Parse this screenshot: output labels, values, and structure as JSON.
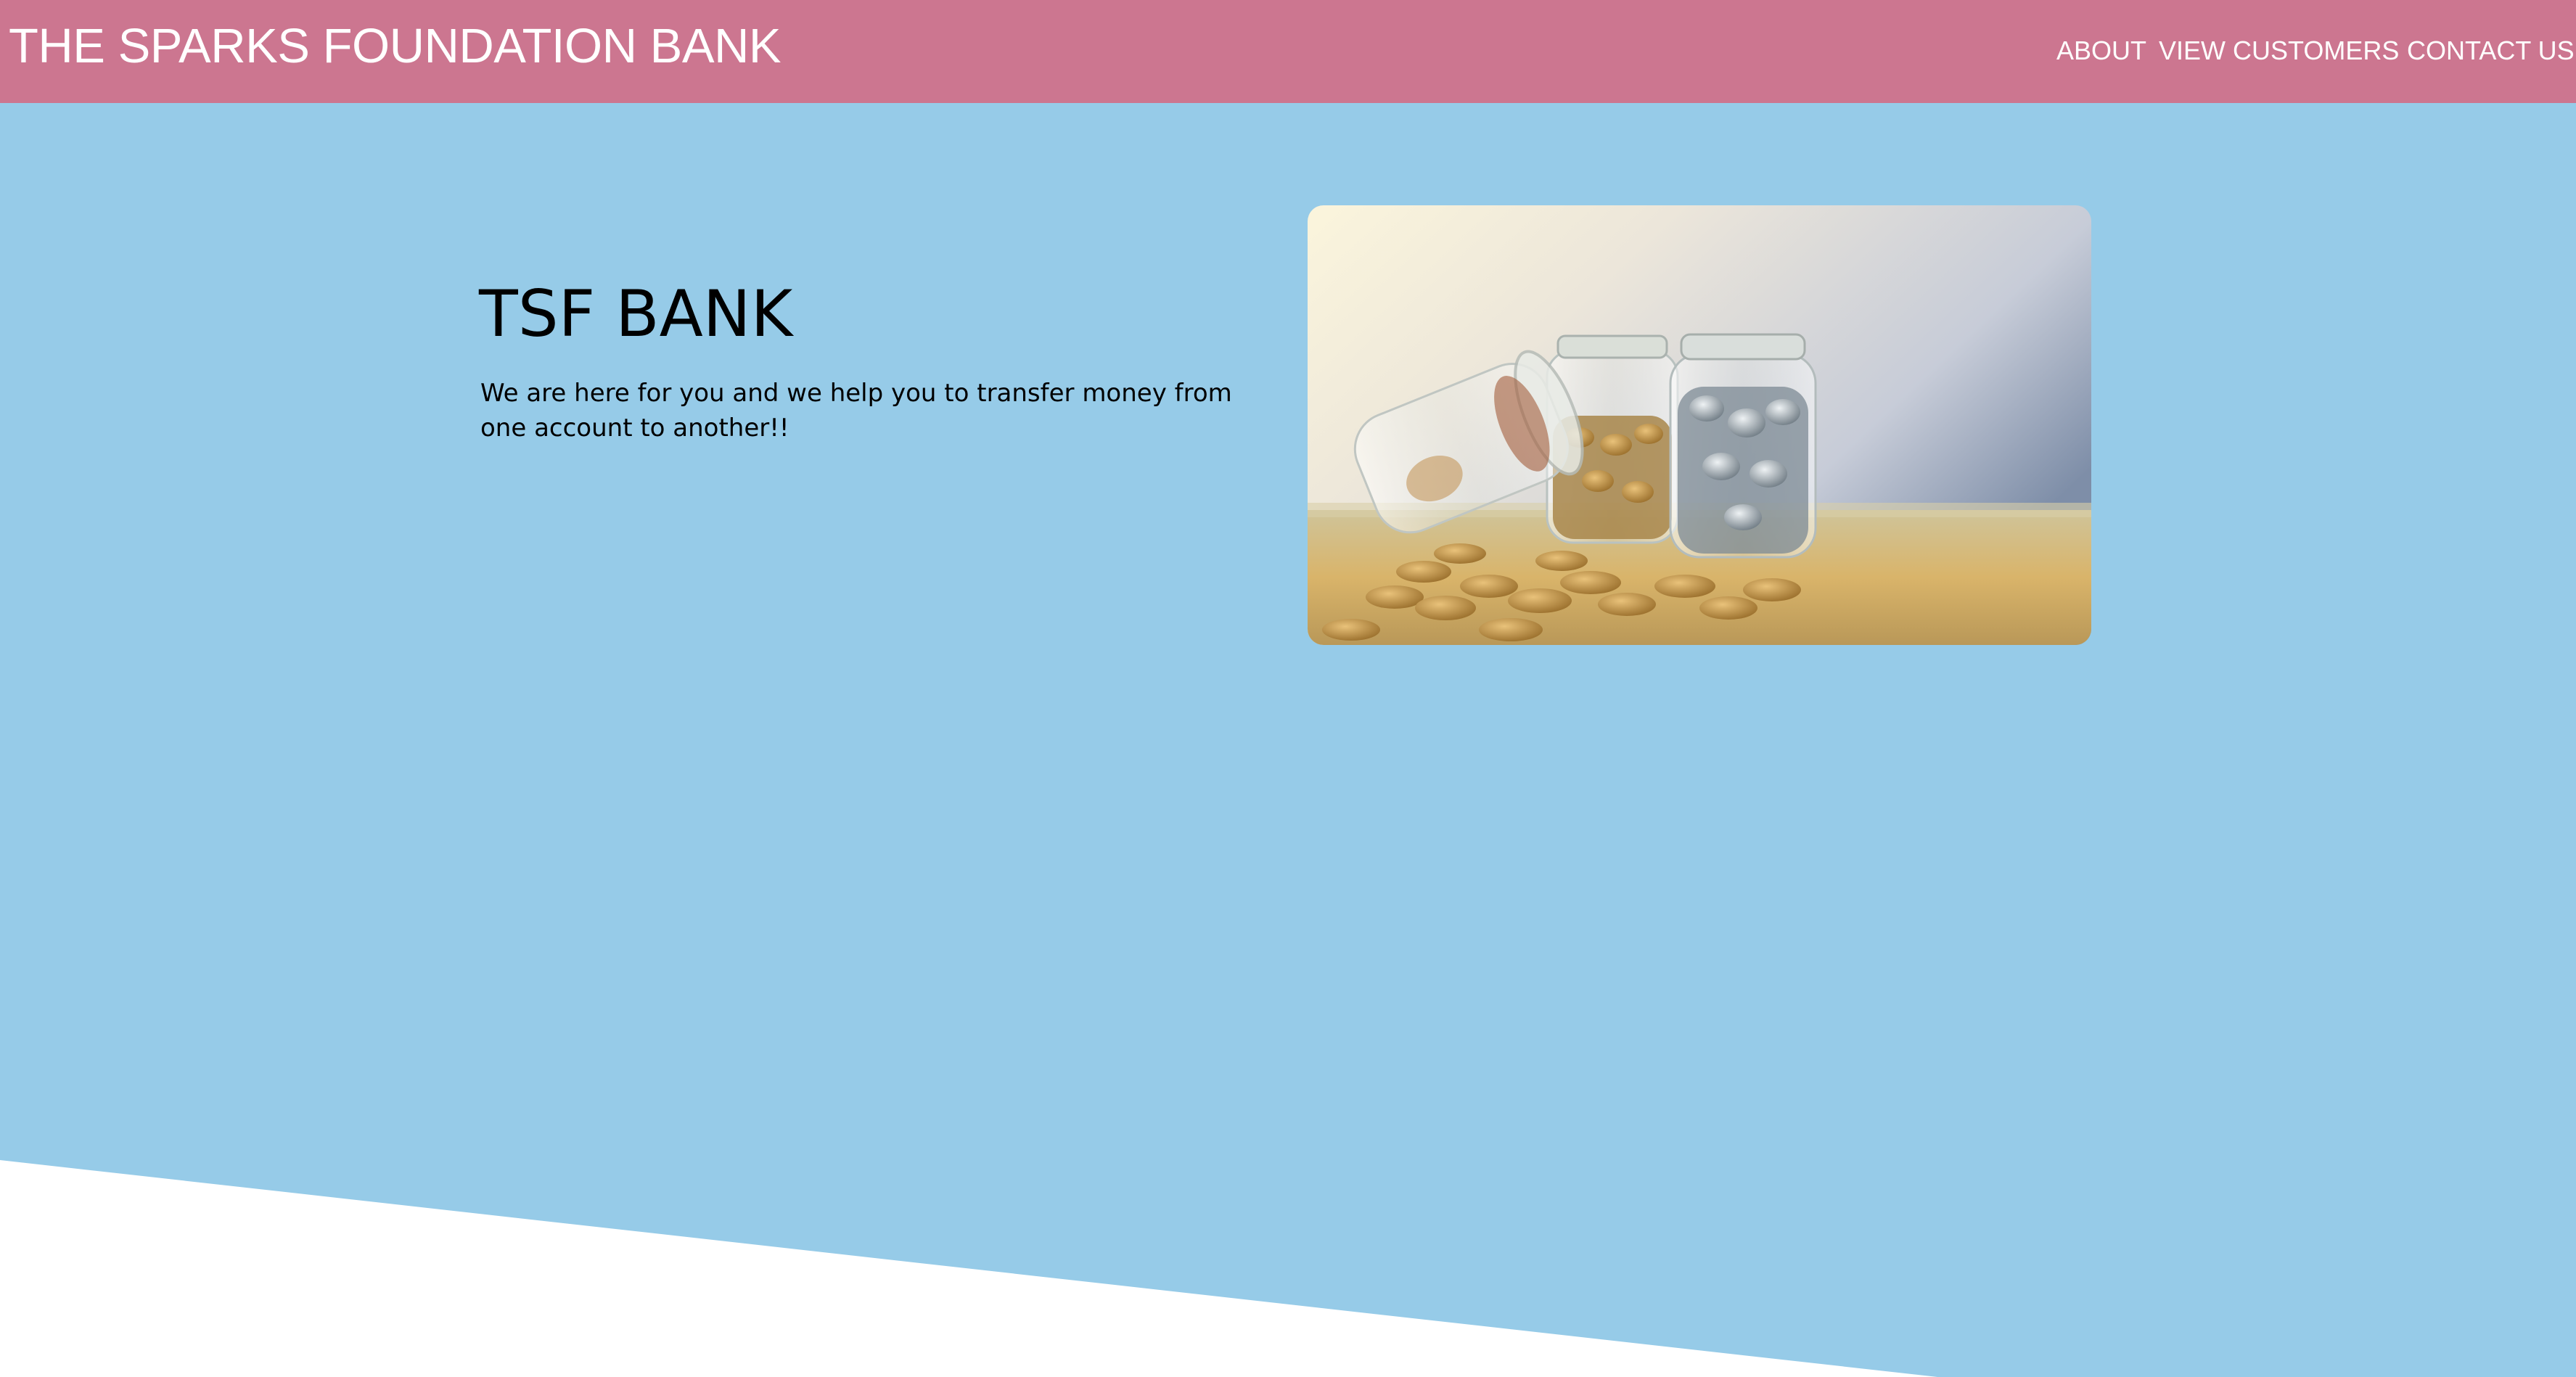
{
  "header": {
    "brand": "THE SPARKS FOUNDATION BANK",
    "nav": [
      {
        "label": "ABOUT"
      },
      {
        "label": "VIEW CUSTOMERS"
      },
      {
        "label": "CONTACT US"
      }
    ]
  },
  "hero": {
    "title": "TSF BANK",
    "description": "We are here for you and we help you to transfer money from one account to another!!",
    "image_subject": "coin-jars-photo"
  },
  "colors": {
    "navbar": "#cc7690",
    "hero_background": "#96cbe8",
    "footer": "#ffffff",
    "text": "#000000",
    "nav_text": "#ffffff"
  }
}
